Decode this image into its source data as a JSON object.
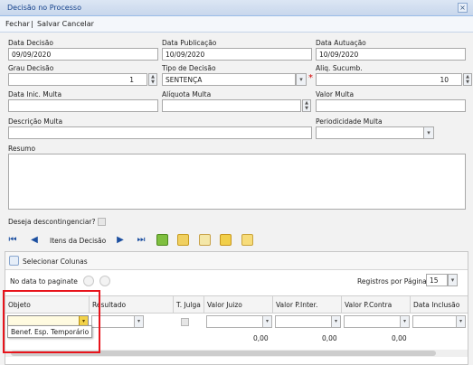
{
  "window": {
    "title": "Decisão no Processo",
    "close_glyph": "×"
  },
  "toolbar": {
    "fechar": "Fechar",
    "sep": "|",
    "salvar_cancelar": "Salvar Cancelar"
  },
  "fields": {
    "data_decisao": {
      "label": "Data Decisão",
      "value": "09/09/2020"
    },
    "data_publicacao": {
      "label": "Data Publicação",
      "value": "10/09/2020"
    },
    "data_autuacao": {
      "label": "Data Autuação",
      "value": "10/09/2020"
    },
    "grau_decisao": {
      "label": "Grau Decisão",
      "value": "1"
    },
    "tipo_decisao": {
      "label": "Tipo de Decisão",
      "value": "SENTENÇA",
      "required_mark": "*"
    },
    "aliq_sucumb": {
      "label": "Aliq. Sucumb.",
      "value": "10"
    },
    "data_inic_multa": {
      "label": "Data Inic. Multa",
      "value": ""
    },
    "aliquota_multa": {
      "label": "Alíquota Multa",
      "value": ""
    },
    "valor_multa": {
      "label": "Valor Multa",
      "value": ""
    },
    "descricao_multa": {
      "label": "Descrição Multa",
      "value": ""
    },
    "periodicidade_multa": {
      "label": "Periodicidade Multa",
      "value": ""
    },
    "resumo": {
      "label": "Resumo",
      "value": ""
    },
    "descontingenciar": {
      "label": "Deseja descontingenciar?"
    }
  },
  "nav": {
    "label": "Itens da Decisão"
  },
  "grid": {
    "select_columns": "Selecionar Colunas",
    "no_data": "No data to paginate",
    "registros_label": "Registros por Página",
    "registros_value": "15",
    "columns": [
      "Objeto",
      "Resultado",
      "T. Julga",
      "Valor Juizo",
      "Valor P.Inter.",
      "Valor P.Contra",
      "Data Inclusão"
    ],
    "totals": {
      "valor_juizo": "0,00",
      "valor_p_inter": "0,00",
      "valor_p_contra": "0,00"
    }
  },
  "popup": {
    "option": "Benef. Esp. Temporário"
  },
  "colors": {
    "accent": "#15428b",
    "highlight": "#e8141c",
    "required": "#d10000"
  }
}
